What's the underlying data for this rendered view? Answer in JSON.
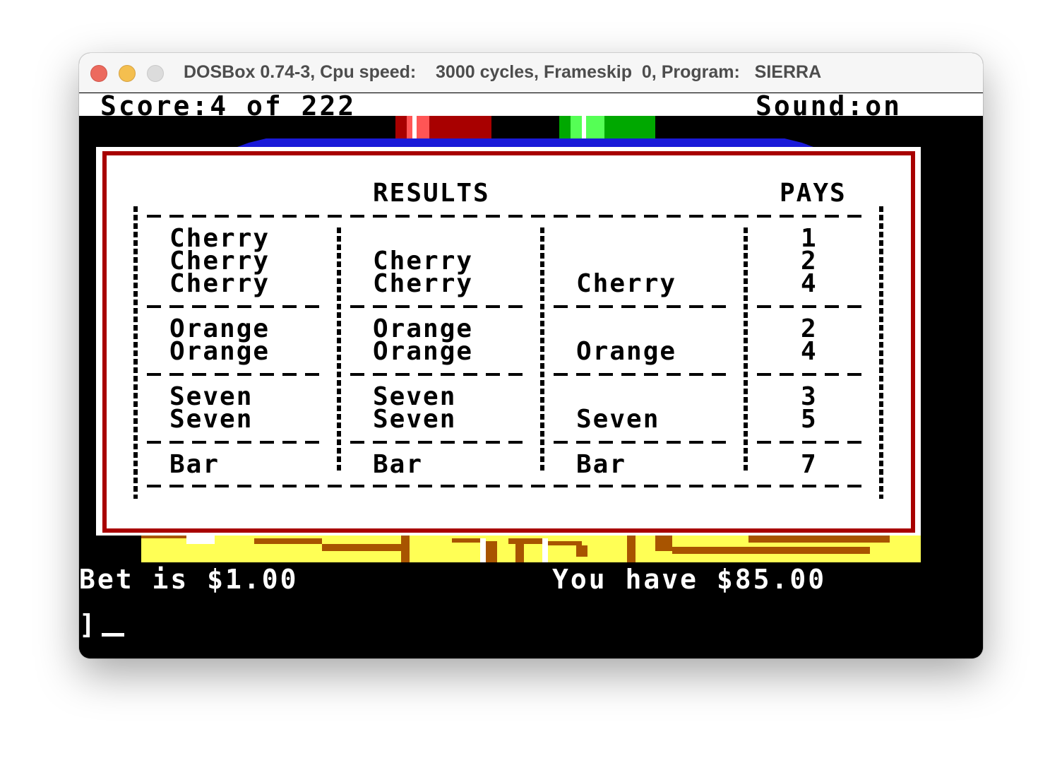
{
  "window": {
    "title": "DOSBox 0.74-3, Cpu speed:    3000 cycles, Frameskip  0, Program:   SIERRA"
  },
  "status": {
    "score": "Score:4 of 222",
    "sound": "Sound:on"
  },
  "dialog": {
    "header_results": "RESULTS",
    "header_pays": "PAYS",
    "rows": [
      {
        "col1": "Cherry\nCherry\nCherry",
        "col2": "Cherry\nCherry",
        "col3": "Cherry",
        "pays": "1\n2\n4"
      },
      {
        "col1": "Orange\nOrange",
        "col2": "Orange\nOrange",
        "col3": "Orange",
        "pays": "2\n4"
      },
      {
        "col1": "Seven\nSeven",
        "col2": "Seven\nSeven",
        "col3": "Seven",
        "pays": "3\n5"
      },
      {
        "col1": "Bar",
        "col2": "Bar",
        "col3": "Bar",
        "pays": "7"
      }
    ]
  },
  "bottom": {
    "bet": "Bet is $1.00",
    "money": "You have $85.00",
    "prompt": "]"
  },
  "colors": {
    "dialog_border": "#a80000",
    "reel_red": "#a80000",
    "reel_green": "#00a800",
    "table_blue": "#1a1ad8",
    "floor_yellow": "#ffff55",
    "floor_brown": "#a85400"
  },
  "icons": {
    "close": "close-traffic-light-icon",
    "minimize": "minimize-traffic-light-icon",
    "maximize": "zoom-traffic-light-icon"
  }
}
